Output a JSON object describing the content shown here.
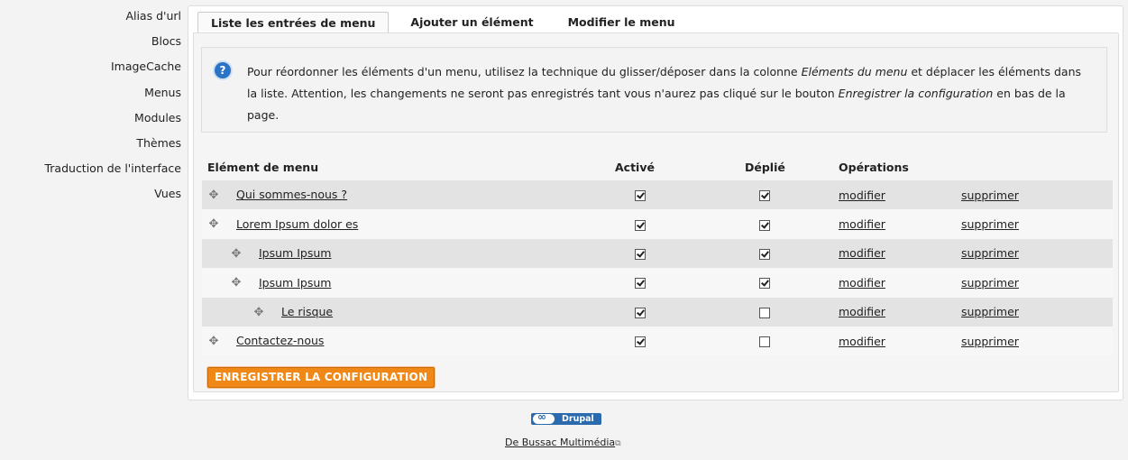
{
  "sidebar": {
    "items": [
      {
        "label": "Alias d'url"
      },
      {
        "label": "Blocs"
      },
      {
        "label": "ImageCache"
      },
      {
        "label": "Menus"
      },
      {
        "label": "Modules"
      },
      {
        "label": "Thèmes"
      },
      {
        "label": "Traduction de l'interface"
      },
      {
        "label": "Vues"
      }
    ]
  },
  "tabs": [
    {
      "label": "Liste les entrées de menu",
      "active": true
    },
    {
      "label": "Ajouter un élément",
      "active": false
    },
    {
      "label": "Modifier le menu",
      "active": false
    }
  ],
  "help": {
    "icon": "question-icon",
    "text_1": "Pour réordonner les éléments d'un menu, utilisez la technique du glisser/déposer dans la colonne ",
    "em_1": "Eléments du menu",
    "text_2": " et déplacer les éléments dans la liste. Attention, les changements ne seront pas enregistrés tant vous n'aurez pas cliqué sur le bouton ",
    "em_2": "Enregistrer la configuration",
    "text_3": " en bas de la page."
  },
  "table": {
    "headers": {
      "item": "Elément de menu",
      "enabled": "Activé",
      "expanded": "Déplié",
      "operations": "Opérations"
    },
    "rows": [
      {
        "label": "Qui sommes-nous ?",
        "depth": 0,
        "enabled": true,
        "expanded": true,
        "edit": "modifier",
        "delete": "supprimer"
      },
      {
        "label": "Lorem Ipsum dolor es",
        "depth": 0,
        "enabled": true,
        "expanded": true,
        "edit": "modifier",
        "delete": "supprimer"
      },
      {
        "label": "Ipsum Ipsum",
        "depth": 1,
        "enabled": true,
        "expanded": true,
        "edit": "modifier",
        "delete": "supprimer"
      },
      {
        "label": "Ipsum Ipsum",
        "depth": 1,
        "enabled": true,
        "expanded": true,
        "edit": "modifier",
        "delete": "supprimer"
      },
      {
        "label": "Le risque",
        "depth": 2,
        "enabled": true,
        "expanded": false,
        "edit": "modifier",
        "delete": "supprimer"
      },
      {
        "label": "Contactez-nous",
        "depth": 0,
        "enabled": true,
        "expanded": false,
        "edit": "modifier",
        "delete": "supprimer"
      }
    ]
  },
  "save_button": "ENREGISTRER LA CONFIGURATION",
  "footer": {
    "badge": "Drupal",
    "link": "De Bussac Multimédia"
  },
  "colors": {
    "accent": "#f08818",
    "help_icon": "#2b73c4",
    "row_odd": "#e3e3e3",
    "row_even": "#f7f7f7"
  }
}
